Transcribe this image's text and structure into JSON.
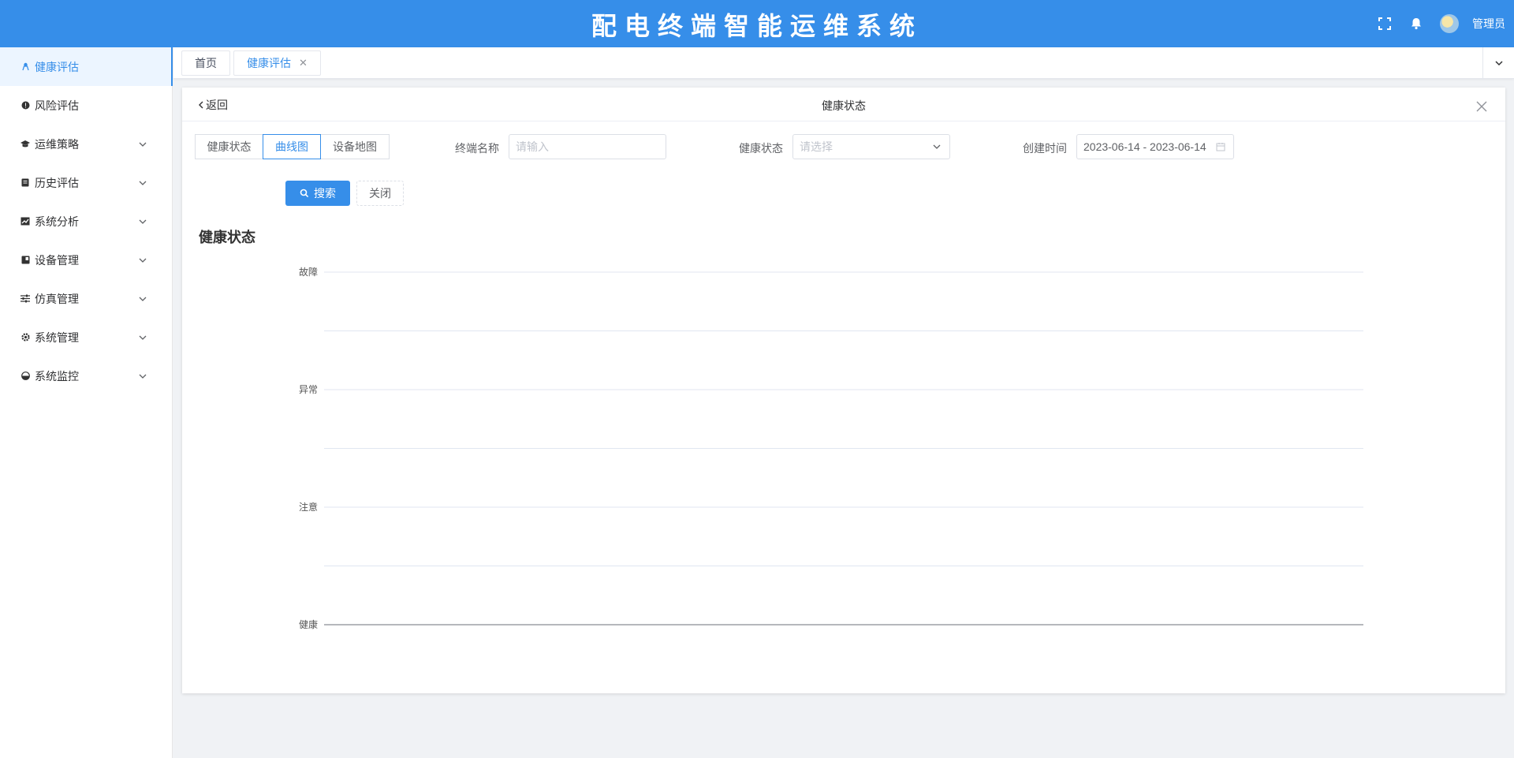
{
  "header": {
    "title": "配电终端智能运维系统",
    "user": "管理员",
    "icons": [
      "fullscreen-icon",
      "bell-icon",
      "avatar"
    ]
  },
  "sidebar": {
    "items": [
      {
        "label": "健康评估",
        "icon": "health-icon",
        "active": true,
        "expandable": false
      },
      {
        "label": "风险评估",
        "icon": "risk-icon",
        "active": false,
        "expandable": false
      },
      {
        "label": "运维策略",
        "icon": "strategy-icon",
        "active": false,
        "expandable": true
      },
      {
        "label": "历史评估",
        "icon": "history-icon",
        "active": false,
        "expandable": true
      },
      {
        "label": "系统分析",
        "icon": "analysis-icon",
        "active": false,
        "expandable": true
      },
      {
        "label": "设备管理",
        "icon": "device-icon",
        "active": false,
        "expandable": true
      },
      {
        "label": "仿真管理",
        "icon": "simulation-icon",
        "active": false,
        "expandable": true
      },
      {
        "label": "系统管理",
        "icon": "settings-icon",
        "active": false,
        "expandable": true
      },
      {
        "label": "系统监控",
        "icon": "monitor-icon",
        "active": false,
        "expandable": true
      }
    ]
  },
  "tabs": [
    {
      "label": "首页",
      "active": false,
      "closable": false
    },
    {
      "label": "健康评估",
      "active": true,
      "closable": true
    }
  ],
  "panel": {
    "back_label": "返回",
    "title": "健康状态",
    "view_buttons": [
      {
        "label": "健康状态",
        "active": false
      },
      {
        "label": "曲线图",
        "active": true
      },
      {
        "label": "设备地图",
        "active": false
      }
    ],
    "filters": {
      "terminal_name_label": "终端名称",
      "terminal_name_placeholder": "请输入",
      "health_status_label": "健康状态",
      "health_status_placeholder": "请选择",
      "created_time_label": "创建时间",
      "created_time_value": "2023-06-14 - 2023-06-14"
    },
    "search_label": "搜索",
    "close_label": "关闭",
    "section_title": "健康状态"
  },
  "chart_data": {
    "type": "line",
    "title": "",
    "xlabel": "",
    "ylabel": "",
    "y_categories": [
      "健康",
      "注意",
      "异常",
      "故障"
    ],
    "x": [],
    "series": [],
    "grid": true
  },
  "colors": {
    "primary": "#368ee9",
    "active_bg": "#ecf5ff",
    "border": "#dcdfe6"
  }
}
